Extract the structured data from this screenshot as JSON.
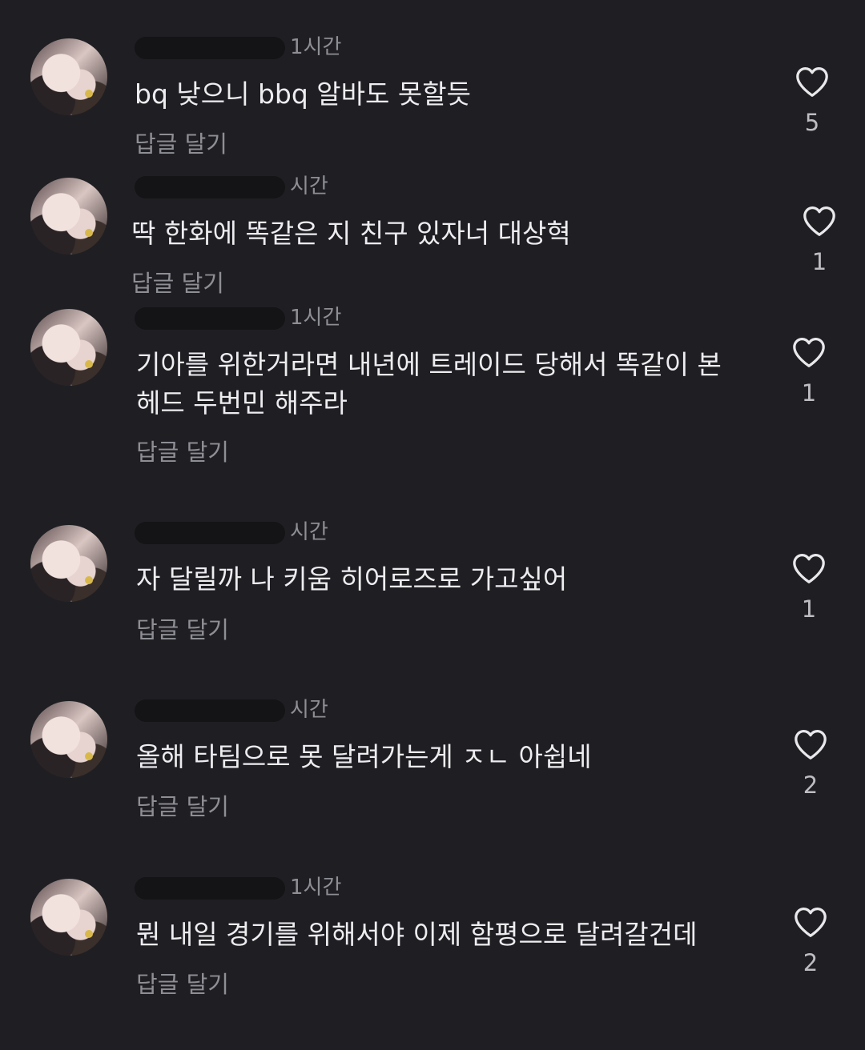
{
  "comments": [
    {
      "time": "1시간",
      "text": "bq 낮으니 bbq 알바도 못할듯",
      "reply_label": "답글 달기",
      "likes": "5"
    },
    {
      "time": "시간",
      "text": "딱 한화에 똑같은 지 친구 있자너 대상혁",
      "reply_label": "답글 달기",
      "likes": "1"
    },
    {
      "time": "1시간",
      "text": "기아를 위한거라면 내년에 트레이드 당해서 똑같이 본헤드 두번민 해주라",
      "reply_label": "답글 달기",
      "likes": "1"
    },
    {
      "time": "시간",
      "text": "자 달릴까 나 키움 히어로즈로 가고싶어",
      "reply_label": "답글 달기",
      "likes": "1"
    },
    {
      "time": "시간",
      "text": "올해 타팀으로 못 달려가는게 ㅈㄴ 아쉽네",
      "reply_label": "답글 달기",
      "likes": "2"
    },
    {
      "time": "1시간",
      "text": "뭔 내일 경기를 위해서야 이제 함평으로 달려갈건데",
      "reply_label": "답글 달기",
      "likes": "2"
    }
  ],
  "icons": {
    "avatar": "avatar-image",
    "like": "heart-outline-icon"
  }
}
